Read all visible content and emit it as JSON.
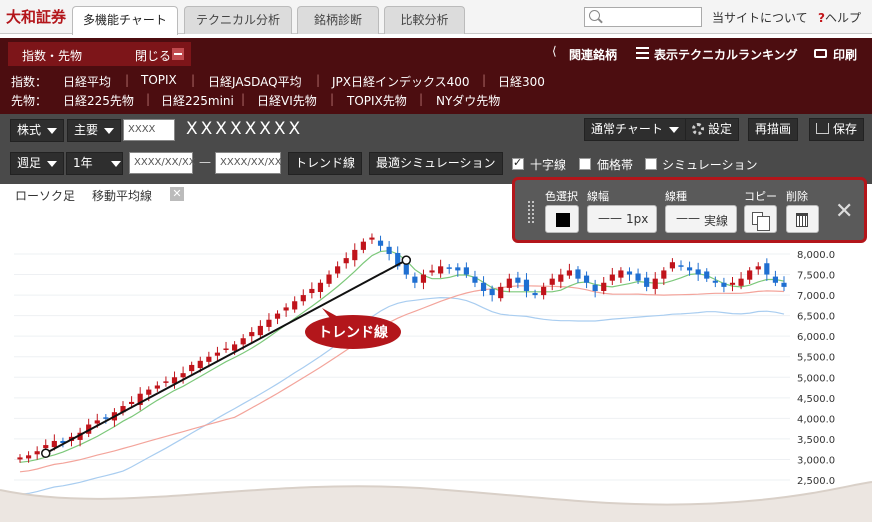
{
  "header": {
    "brand": "大和証券",
    "tabs": [
      {
        "label": "多機能チャート",
        "active": true
      },
      {
        "label": "テクニカル分析",
        "active": false
      },
      {
        "label": "銘柄診断",
        "active": false
      },
      {
        "label": "比較分析",
        "active": false
      }
    ],
    "about_link": "当サイトについて",
    "help_mark": "?",
    "help_link": "ヘルプ"
  },
  "panel": {
    "title": "指数・先物",
    "close_label": "閉じる",
    "related_label": "関連銘柄",
    "ranking_label": "表示テクニカルランキング",
    "print_label": "印刷",
    "index_row_label": "指数：",
    "index_items": [
      "日経平均",
      "TOPIX",
      "日経JASDAQ平均",
      "JPX日経インデックス400",
      "日経300"
    ],
    "futures_row_label": "先物：",
    "futures_items": [
      "日経225先物",
      "日経225mini",
      "日経VI先物",
      "TOPIX先物",
      "NYダウ先物"
    ]
  },
  "toolbar": {
    "market_select": "株式",
    "type_select": "主要",
    "code_input": "XXXX",
    "stock_name": "XXXXXXXX",
    "chart_type_select": "通常チャート",
    "settings_label": "設定",
    "redraw_label": "再描画",
    "save_label": "保存",
    "period_unit_select": "週足",
    "period_select": "1年",
    "date_from": "XXXX/XX/XX",
    "date_sep": "—",
    "date_to": "XXXX/XX/XX",
    "trendline_button": "トレンド線",
    "optimize_button": "最適シミュレーション",
    "crosshair_label": "十字線",
    "crosshair_checked": true,
    "price_band_label": "価格帯",
    "price_band_checked": false,
    "simulation_label": "シミュレーション",
    "simulation_checked": false
  },
  "chart": {
    "candle_tag": "ローソク足",
    "ma_tag": "移動平均線",
    "trend_callout": "トレンド線",
    "colors": {
      "up": "#c0141b",
      "down": "#1f6fd1",
      "ma_short": "#7cc87a",
      "ma_mid": "#f3a49b",
      "ma_long": "#a9cdf0",
      "trend": "#111111"
    }
  },
  "popup": {
    "color_label": "色選択",
    "width_label": "線幅",
    "width_value": "1px",
    "style_label": "線種",
    "style_value": "実線",
    "copy_label": "コピー",
    "delete_label": "削除",
    "selected_color": "#000000"
  },
  "chart_data": {
    "type": "candlestick",
    "ytick_labels": [
      "8,000.0",
      "7,500.0",
      "7,000.0",
      "6,500.0",
      "6,000.0",
      "5,500.0",
      "5,000.0",
      "4,500.0",
      "4,000.0",
      "3,500.0",
      "3,000.0",
      "2,500.0"
    ],
    "y_ticks": [
      8000,
      7500,
      7000,
      6500,
      6000,
      5500,
      5000,
      4500,
      4000,
      3500,
      3000,
      2500
    ],
    "ylim": [
      2400,
      8300
    ],
    "grid": true,
    "close": [
      3050,
      3100,
      3200,
      3350,
      3450,
      3400,
      3550,
      3650,
      3850,
      3950,
      4000,
      4150,
      4300,
      4400,
      4600,
      4700,
      4800,
      4900,
      5000,
      5100,
      5300,
      5400,
      5500,
      5600,
      5700,
      5800,
      5950,
      6100,
      6250,
      6400,
      6550,
      6700,
      6850,
      7000,
      7150,
      7300,
      7500,
      7700,
      7900,
      8100,
      8300,
      8400,
      8200,
      8000,
      7700,
      7500,
      7300,
      7500,
      7600,
      7700,
      7650,
      7600,
      7500,
      7300,
      7100,
      7000,
      7200,
      7400,
      7300,
      7100,
      7000,
      7200,
      7400,
      7500,
      7600,
      7400,
      7300,
      7100,
      7300,
      7500,
      7600,
      7500,
      7350,
      7200,
      7400,
      7600,
      7800,
      7700,
      7600,
      7500,
      7400,
      7300,
      7200,
      7300,
      7400,
      7600,
      7700,
      7500,
      7300,
      7200
    ],
    "trend_line": {
      "start_week": 3,
      "start_value": 3150,
      "end_week": 45,
      "end_value": 7850
    }
  }
}
